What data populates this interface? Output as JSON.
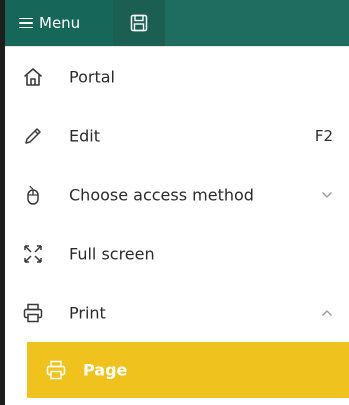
{
  "topbar": {
    "menu_label": "Menu",
    "menu_icon": "hamburger-icon",
    "save_icon": "save-icon",
    "brand_color": "#16675a"
  },
  "menu": {
    "items": [
      {
        "label": "Portal",
        "icon": "home-icon",
        "shortcut": "",
        "chevron": ""
      },
      {
        "label": "Edit",
        "icon": "pencil-icon",
        "shortcut": "F2",
        "chevron": ""
      },
      {
        "label": "Choose access method",
        "icon": "mouse-icon",
        "shortcut": "",
        "chevron": "down"
      },
      {
        "label": "Full screen",
        "icon": "fullscreen-icon",
        "shortcut": "",
        "chevron": ""
      },
      {
        "label": "Print",
        "icon": "printer-icon",
        "shortcut": "",
        "chevron": "up"
      }
    ],
    "submenu": [
      {
        "label": "Page",
        "icon": "printer-icon",
        "highlight_color": "#f0c21e"
      }
    ]
  }
}
